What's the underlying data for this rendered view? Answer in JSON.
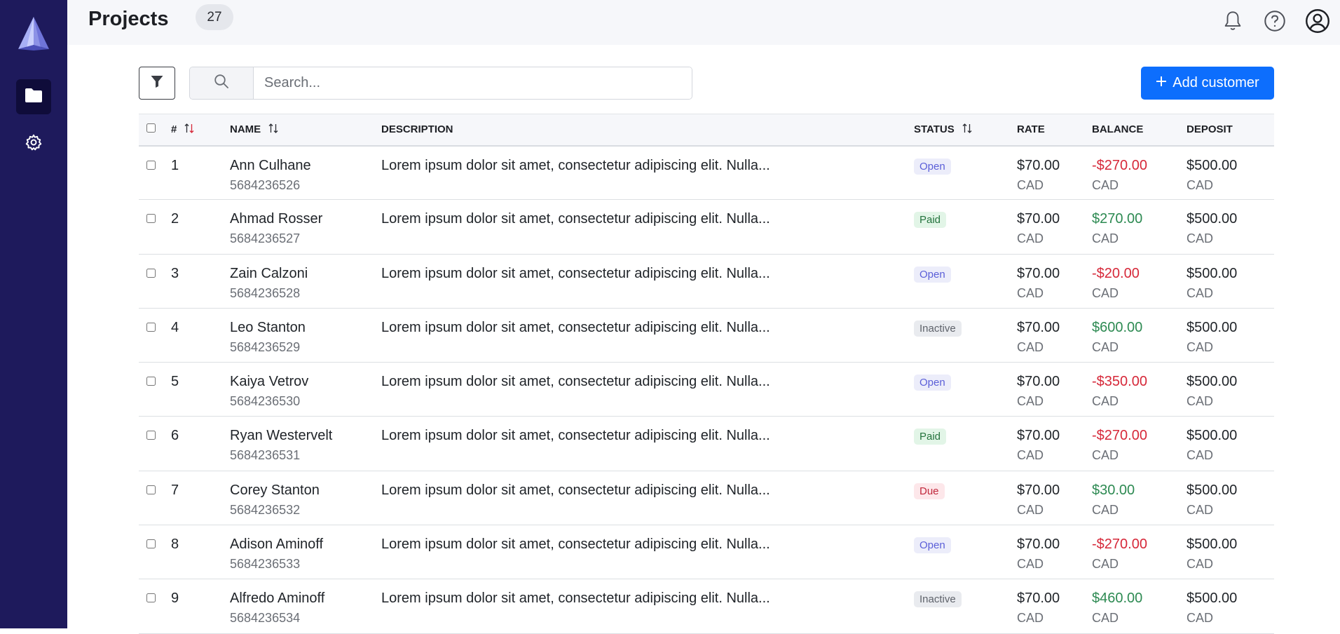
{
  "header": {
    "title": "Projects",
    "count": "27"
  },
  "toolbar": {
    "search_placeholder": "Search...",
    "add_label": "Add customer"
  },
  "table": {
    "columns": {
      "num": "#",
      "name": "NAME",
      "description": "DESCRIPTION",
      "status": "STATUS",
      "rate": "RATE",
      "balance": "BALANCE",
      "deposit": "DEPOSIT"
    },
    "rows": [
      {
        "num": "1",
        "name": "Ann Culhane",
        "id": "5684236526",
        "description": "Lorem ipsum dolor sit amet, consectetur adipiscing elit. Nulla...",
        "status": "Open",
        "status_kind": "open",
        "rate": "$70.00",
        "rate_currency": "CAD",
        "balance": "-$270.00",
        "balance_kind": "neg",
        "balance_currency": "CAD",
        "deposit": "$500.00",
        "deposit_currency": "CAD"
      },
      {
        "num": "2",
        "name": "Ahmad Rosser",
        "id": "5684236527",
        "description": "Lorem ipsum dolor sit amet, consectetur adipiscing elit. Nulla...",
        "status": "Paid",
        "status_kind": "paid",
        "rate": "$70.00",
        "rate_currency": "CAD",
        "balance": "$270.00",
        "balance_kind": "pos",
        "balance_currency": "CAD",
        "deposit": "$500.00",
        "deposit_currency": "CAD"
      },
      {
        "num": "3",
        "name": "Zain Calzoni",
        "id": "5684236528",
        "description": "Lorem ipsum dolor sit amet, consectetur adipiscing elit. Nulla...",
        "status": "Open",
        "status_kind": "open",
        "rate": "$70.00",
        "rate_currency": "CAD",
        "balance": "-$20.00",
        "balance_kind": "neg",
        "balance_currency": "CAD",
        "deposit": "$500.00",
        "deposit_currency": "CAD"
      },
      {
        "num": "4",
        "name": "Leo Stanton",
        "id": "5684236529",
        "description": "Lorem ipsum dolor sit amet, consectetur adipiscing elit. Nulla...",
        "status": "Inactive",
        "status_kind": "inactive",
        "rate": "$70.00",
        "rate_currency": "CAD",
        "balance": "$600.00",
        "balance_kind": "pos",
        "balance_currency": "CAD",
        "deposit": "$500.00",
        "deposit_currency": "CAD"
      },
      {
        "num": "5",
        "name": "Kaiya Vetrov",
        "id": "5684236530",
        "description": "Lorem ipsum dolor sit amet, consectetur adipiscing elit. Nulla...",
        "status": "Open",
        "status_kind": "open",
        "rate": "$70.00",
        "rate_currency": "CAD",
        "balance": "-$350.00",
        "balance_kind": "neg",
        "balance_currency": "CAD",
        "deposit": "$500.00",
        "deposit_currency": "CAD"
      },
      {
        "num": "6",
        "name": "Ryan Westervelt",
        "id": "5684236531",
        "description": "Lorem ipsum dolor sit amet, consectetur adipiscing elit. Nulla...",
        "status": "Paid",
        "status_kind": "paid",
        "rate": "$70.00",
        "rate_currency": "CAD",
        "balance": "-$270.00",
        "balance_kind": "neg",
        "balance_currency": "CAD",
        "deposit": "$500.00",
        "deposit_currency": "CAD"
      },
      {
        "num": "7",
        "name": "Corey Stanton",
        "id": "5684236532",
        "description": "Lorem ipsum dolor sit amet, consectetur adipiscing elit. Nulla...",
        "status": "Due",
        "status_kind": "due",
        "rate": "$70.00",
        "rate_currency": "CAD",
        "balance": "$30.00",
        "balance_kind": "pos",
        "balance_currency": "CAD",
        "deposit": "$500.00",
        "deposit_currency": "CAD"
      },
      {
        "num": "8",
        "name": "Adison Aminoff",
        "id": "5684236533",
        "description": "Lorem ipsum dolor sit amet, consectetur adipiscing elit. Nulla...",
        "status": "Open",
        "status_kind": "open",
        "rate": "$70.00",
        "rate_currency": "CAD",
        "balance": "-$270.00",
        "balance_kind": "neg",
        "balance_currency": "CAD",
        "deposit": "$500.00",
        "deposit_currency": "CAD"
      },
      {
        "num": "9",
        "name": "Alfredo Aminoff",
        "id": "5684236534",
        "description": "Lorem ipsum dolor sit amet, consectetur adipiscing elit. Nulla...",
        "status": "Inactive",
        "status_kind": "inactive",
        "rate": "$70.00",
        "rate_currency": "CAD",
        "balance": "$460.00",
        "balance_kind": "pos",
        "balance_currency": "CAD",
        "deposit": "$500.00",
        "deposit_currency": "CAD"
      }
    ]
  },
  "colors": {
    "sidebar": "#1e1a5c",
    "accent": "#0d6efd",
    "negative": "#d62839",
    "positive": "#2d8a52"
  },
  "icons": {
    "logo": "pyramid-logo",
    "nav": [
      "folder-icon",
      "gear-icon"
    ],
    "topbar": [
      "bell-icon",
      "help-icon",
      "user-circle-icon"
    ]
  }
}
